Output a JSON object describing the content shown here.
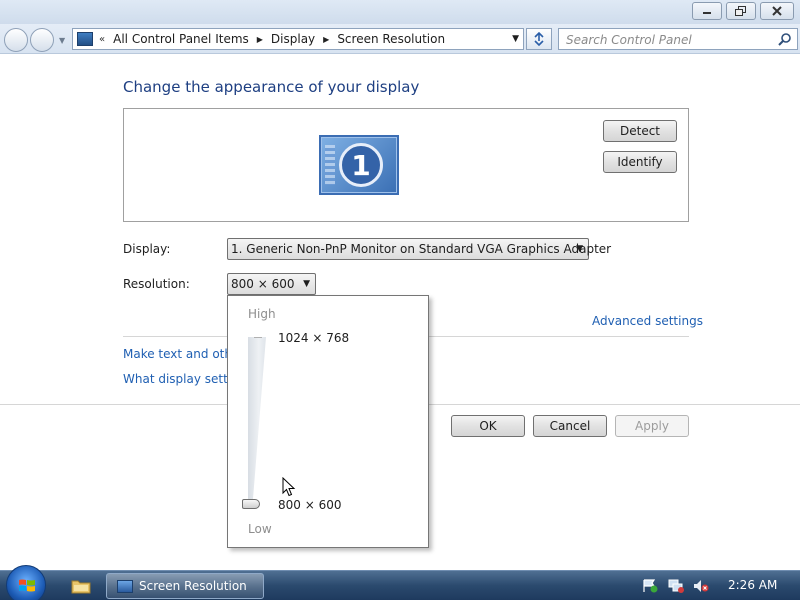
{
  "window": {
    "minimize_icon": "minimize-icon",
    "maximize_icon": "restore-icon",
    "close_icon": "close-icon"
  },
  "address_bar": {
    "overflow": "«",
    "crumbs": [
      "All Control Panel Items",
      "Display",
      "Screen Resolution"
    ],
    "search_placeholder": "Search Control Panel"
  },
  "page": {
    "heading": "Change the appearance of your display",
    "monitor_number": "1",
    "detect_label": "Detect",
    "identify_label": "Identify",
    "display_label": "Display:",
    "display_value": "1. Generic Non-PnP Monitor on Standard VGA Graphics Adapter",
    "resolution_label": "Resolution:",
    "resolution_value": "800 × 600",
    "advanced_link": "Advanced settings",
    "link1": "Make text and other",
    "link2": "What display setting",
    "ok_label": "OK",
    "cancel_label": "Cancel",
    "apply_label": "Apply"
  },
  "resolution_popup": {
    "high_label": "High",
    "low_label": "Low",
    "max_option": "1024 × 768",
    "min_option": "800 × 600",
    "slider_value_fraction": 0
  },
  "taskbar": {
    "task_label": "Screen Resolution",
    "clock": "2:26 AM"
  },
  "colors": {
    "link": "#1f5fb2",
    "heading": "#1e3f82",
    "taskbar": "#2b4a6e"
  }
}
